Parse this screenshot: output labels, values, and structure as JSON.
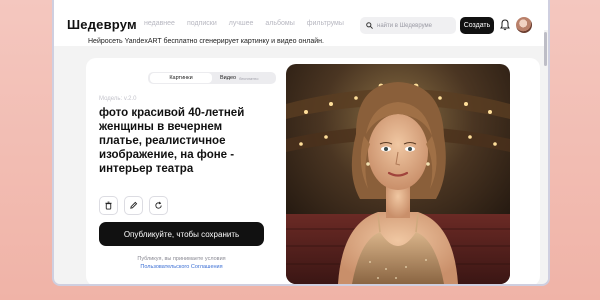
{
  "header": {
    "logo": "Шедеврум",
    "nav": [
      "недавнее",
      "подписки",
      "лучшее",
      "альбомы",
      "фильтрумы"
    ],
    "search_placeholder": "найти в Шедевруме",
    "create_label": "Создать",
    "icons": [
      "search-icon",
      "bell-icon",
      "avatar"
    ]
  },
  "subtitle": "Нейросеть YandexART бесплатно сгенерирует картинку и видео онлайн.",
  "card": {
    "tabs": [
      {
        "label": "Картинки",
        "active": true
      },
      {
        "label": "Видео",
        "note": "бесплатно",
        "active": false
      }
    ],
    "model": "Модель: v.2.0",
    "prompt": "фото красивой 40-летней\nженщины в вечернем\nплатье, реалистичное\nизображение, на фоне -\nинтерьер театра",
    "tools": [
      "delete-icon",
      "edit-icon",
      "regenerate-icon"
    ],
    "publish_label": "Опубликуйте, чтобы сохранить",
    "terms_text": "Публикуя, вы принимаете условия",
    "terms_link": "Пользовательского Соглашения"
  },
  "colors": {
    "background": "#f0b3a7",
    "primary_button": "#111111",
    "link": "#3b6fd4"
  }
}
